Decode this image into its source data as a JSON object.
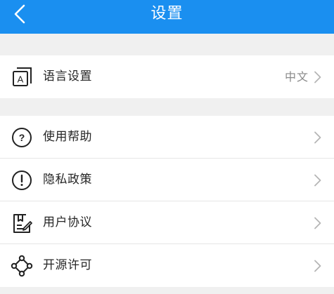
{
  "header": {
    "title": "设置",
    "background": "#1a8ff0"
  },
  "groups": [
    {
      "items": [
        {
          "icon": "language-icon",
          "label": "语言设置",
          "value": "中文"
        }
      ]
    },
    {
      "items": [
        {
          "icon": "help-question-icon",
          "label": "使用帮助"
        },
        {
          "icon": "privacy-exclamation-icon",
          "label": "隐私政策"
        },
        {
          "icon": "agreement-document-icon",
          "label": "用户协议"
        },
        {
          "icon": "open-source-nodes-icon",
          "label": "开源许可"
        }
      ]
    }
  ]
}
